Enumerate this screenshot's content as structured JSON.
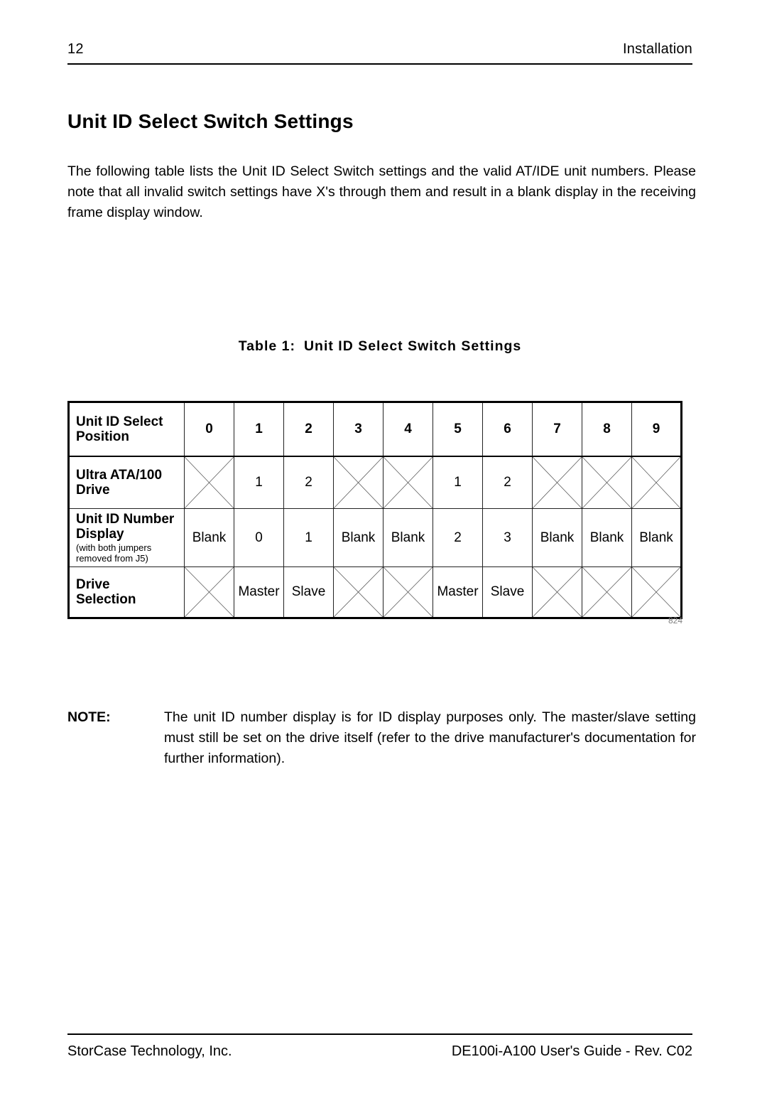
{
  "header": {
    "page_number": "12",
    "section": "Installation"
  },
  "section_title": "Unit ID Select Switch Settings",
  "intro": {
    "paragraph": "The following table lists the Unit ID Select Switch settings and the valid AT/IDE unit numbers. Please note that all invalid switch settings have X's through them and result in a blank display in the receiving frame display window."
  },
  "table": {
    "caption_label": "Table 1:",
    "caption_title": "Unit ID Select Switch Settings",
    "figure_ref": "824",
    "row_labels": {
      "position": "Unit ID Select Position",
      "position_line1": "Unit ID Select",
      "position_line2": "Position",
      "ata_line1": "Ultra ATA/100",
      "ata_line2": "Drive",
      "display_line1": "Unit ID Number",
      "display_line2": "Display",
      "display_sub_line1": "(with both jumpers",
      "display_sub_line2": "removed from J5)",
      "selection_line1": "Drive",
      "selection_line2": "Selection"
    },
    "columns": [
      "0",
      "1",
      "2",
      "3",
      "4",
      "5",
      "6",
      "7",
      "8",
      "9"
    ],
    "rows": [
      {
        "label": "Ultra ATA/100 Drive",
        "cells": [
          "X",
          "1",
          "2",
          "X",
          "X",
          "1",
          "2",
          "X",
          "X",
          "X"
        ]
      },
      {
        "label": "Unit ID Number Display",
        "cells": [
          "Blank",
          "0",
          "1",
          "Blank",
          "Blank",
          "2",
          "3",
          "Blank",
          "Blank",
          "Blank"
        ]
      },
      {
        "label": "Drive Selection",
        "cells": [
          "X",
          "Master",
          "Slave",
          "X",
          "X",
          "Master",
          "Slave",
          "X",
          "X",
          "X"
        ]
      }
    ]
  },
  "note": {
    "label": "NOTE:",
    "text": "The unit ID number display is for ID display purposes only.  The master/slave setting must still be set on the drive itself (refer to the drive manufacturer's documentation for further information)."
  },
  "footer": {
    "company": "StorCase Technology, Inc.",
    "document": "DE100i-A100 User's Guide - Rev. C02"
  }
}
